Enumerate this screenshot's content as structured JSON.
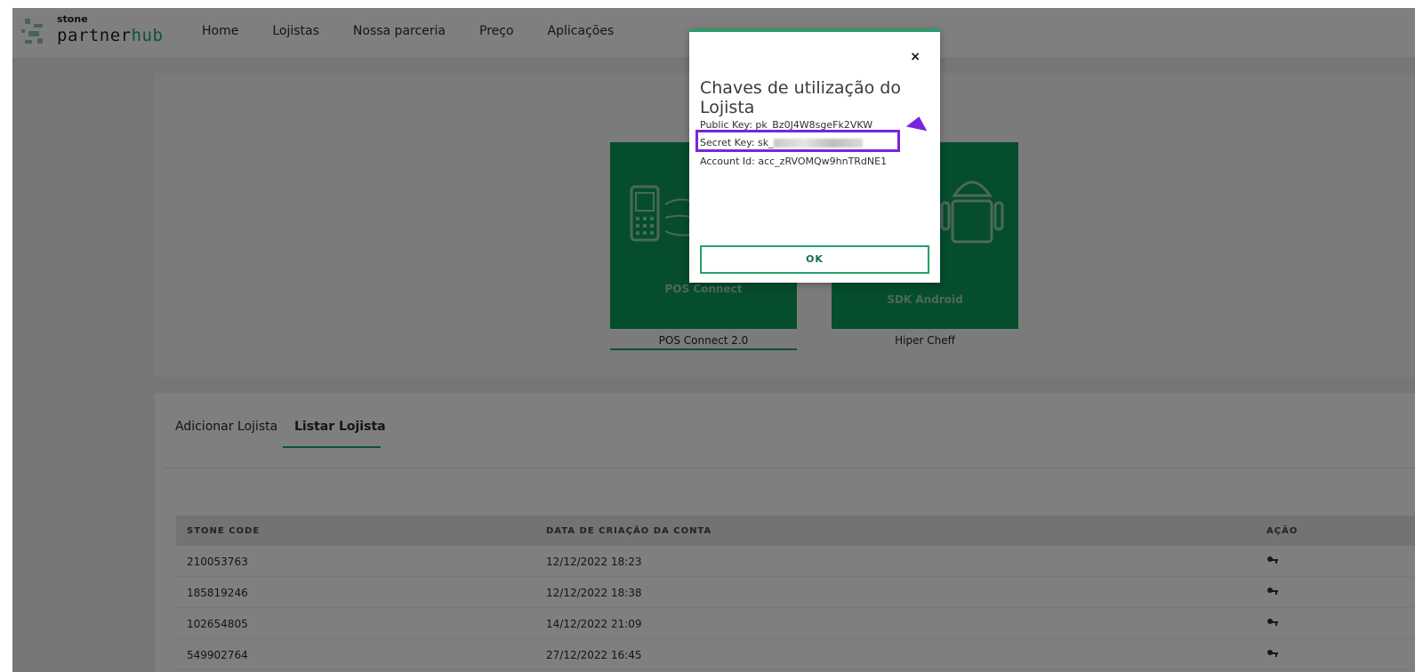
{
  "brand": {
    "top": "stone",
    "word_left": "partner",
    "word_right": "hub"
  },
  "nav": {
    "items": [
      "Home",
      "Lojistas",
      "Nossa parceria",
      "Preço",
      "Aplicações"
    ]
  },
  "apps": [
    {
      "label": "POS Connect",
      "caption": "POS Connect 2.0",
      "icon": "pos-terminal-icon"
    },
    {
      "label": "SDK Android",
      "caption": "Hiper Cheff",
      "icon": "android-icon"
    }
  ],
  "tabs": {
    "items": [
      "Adicionar Lojista",
      "Listar Lojista"
    ],
    "active": "Listar Lojista"
  },
  "table": {
    "headers": [
      "STONE CODE",
      "DATA DE CRIAÇÃO DA CONTA",
      "AÇÃO"
    ],
    "rows": [
      {
        "code": "210053763",
        "date": "12/12/2022 18:23"
      },
      {
        "code": "185819246",
        "date": "12/12/2022 18:38"
      },
      {
        "code": "102654805",
        "date": "14/12/2022 21:09"
      },
      {
        "code": "549902764",
        "date": "27/12/2022 16:45"
      }
    ],
    "action_icon": "key-icon"
  },
  "modal": {
    "close": "×",
    "title": "Chaves de utilização do Lojista",
    "public_key": "Public Key: pk_Bz0J4W8sgeFk2VKW",
    "secret_key_prefix": "Secret Key: sk_",
    "account_id": "Account Id: acc_zRVOMQw9hnTRdNE1",
    "ok": "OK"
  },
  "colors": {
    "accent": "#1ea36a",
    "card": "#0a9b5a",
    "highlight": "#7a24e0"
  }
}
